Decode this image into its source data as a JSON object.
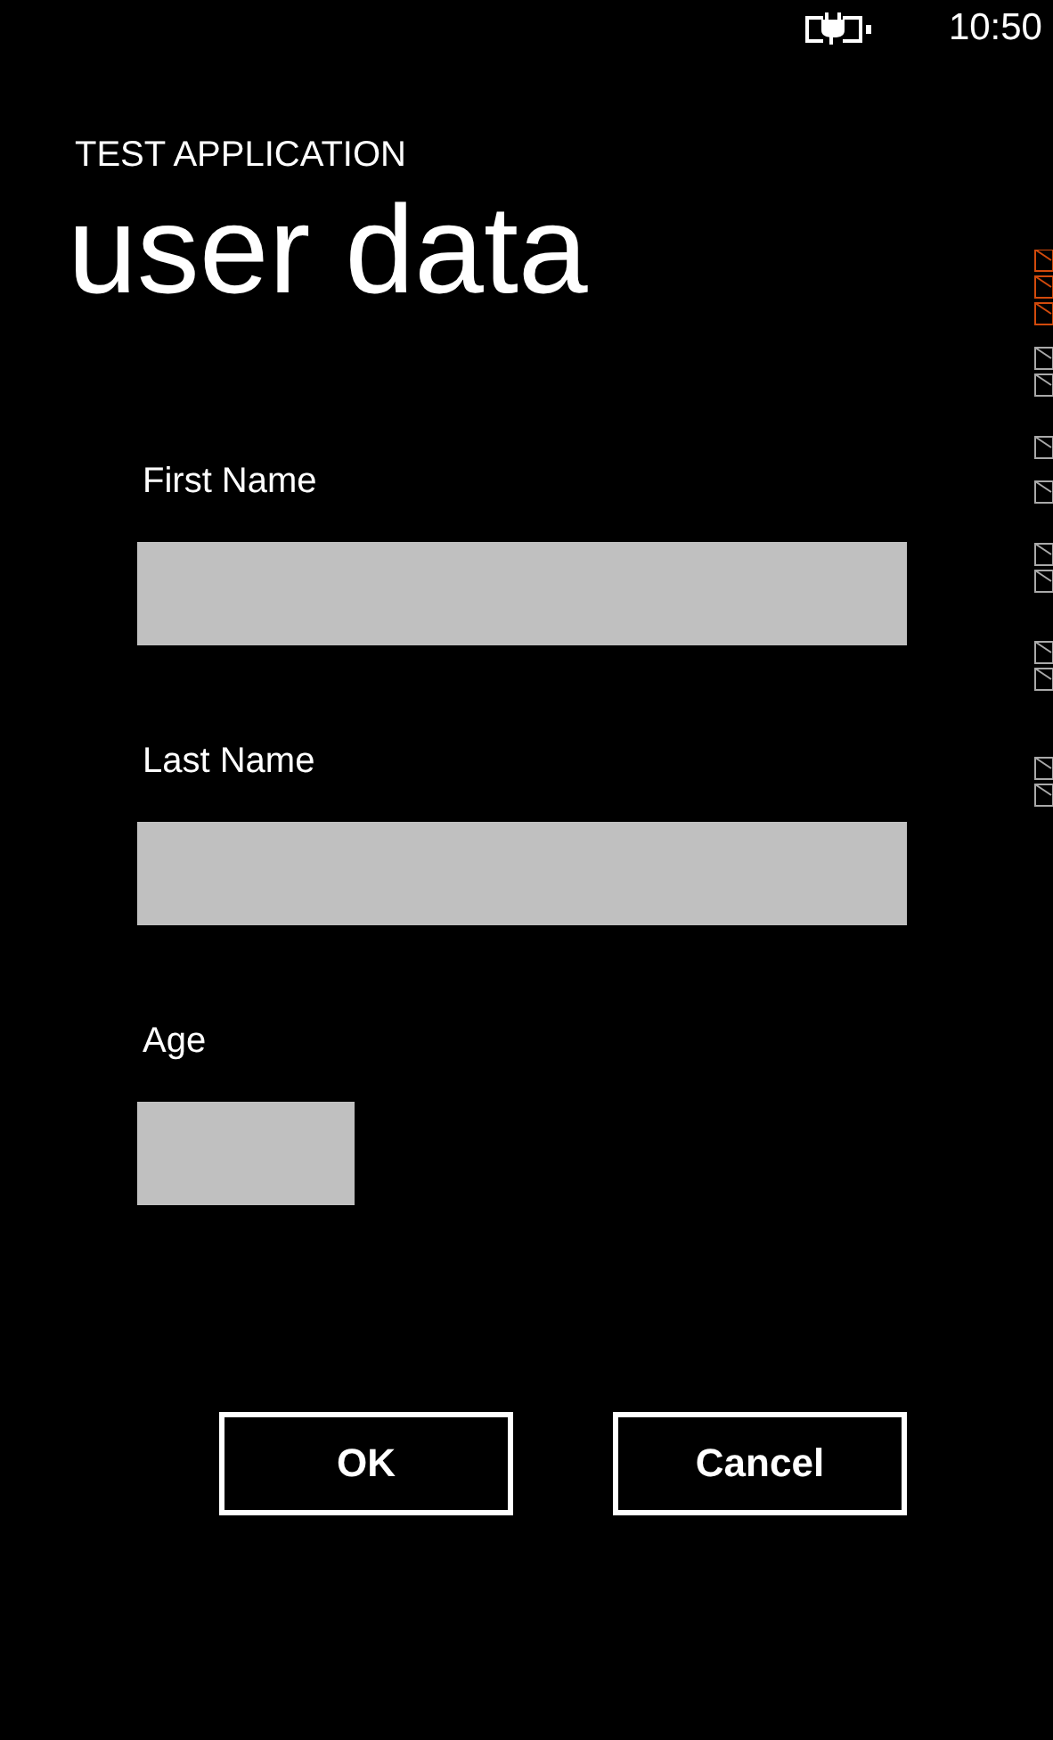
{
  "status_bar": {
    "time": "10:50"
  },
  "app_title": "TEST APPLICATION",
  "page_title": "user data",
  "fields": [
    {
      "label": "First Name",
      "kind": "wide"
    },
    {
      "label": "Last Name",
      "kind": "wide"
    },
    {
      "label": "Age",
      "kind": "short"
    }
  ],
  "buttons": [
    "OK",
    "Cancel"
  ]
}
